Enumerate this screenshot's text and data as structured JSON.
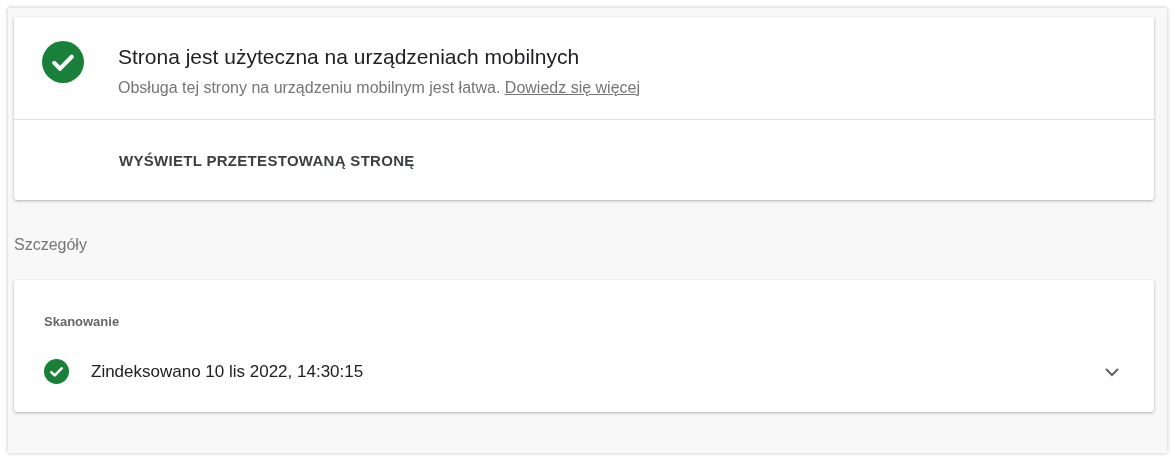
{
  "result": {
    "passed": true,
    "title": "Strona jest użyteczna na urządzeniach mobilnych",
    "description": "Obsługa tej strony na urządzeniu mobilnym jest łatwa.",
    "link": "Dowiedz się więcej",
    "action": "WYŚWIETL PRZETESTOWANĄ STRONĘ"
  },
  "details": {
    "heading": "Szczegóły",
    "sections": [
      {
        "label": "Skanowanie",
        "passed": true,
        "text": "Zindeksowano 10 lis 2022, 14:30:15",
        "expanded": false
      }
    ]
  }
}
